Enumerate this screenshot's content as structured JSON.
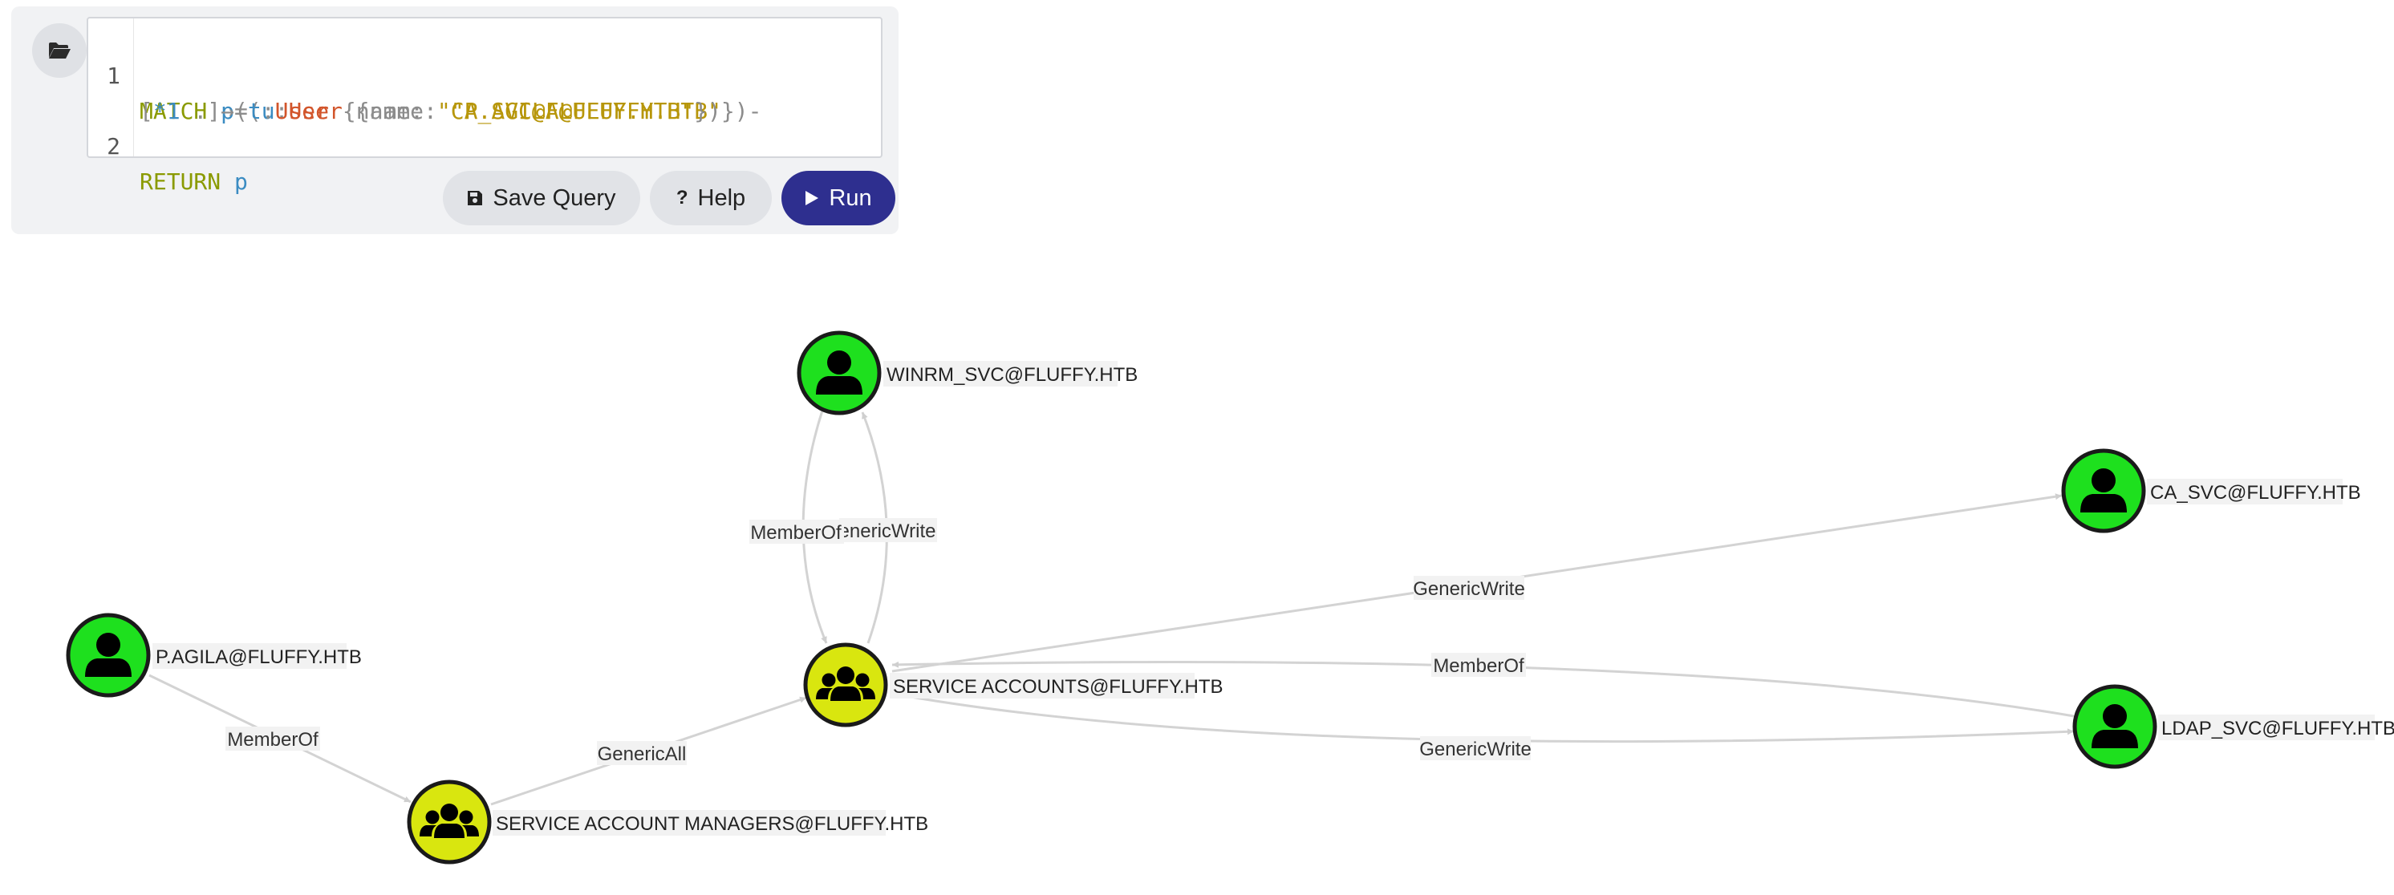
{
  "query": {
    "lines": [
      {
        "number": "1",
        "text": "MATCH p=(u:User {name: \"P.AGILA@FLUFFY.HTB\"})-[*1 .]→(t:User {name: \"CA_SVC@FLUFFY.HTB\"})"
      },
      {
        "number": "2",
        "text": "RETURN p"
      }
    ],
    "tokens": {
      "match": "MATCH",
      "p": "p",
      "eq": "=(",
      "u": "u",
      "colon": ":",
      "user": "User",
      "brace_open": " {",
      "name_key": "name: ",
      "name1": "\"P.AGILA@FLUFFY.HTB\"",
      "close1": "})-",
      "rel_open": "[",
      "rel_star": "*1",
      "rel_dot": " .",
      "rel_close": "]→(",
      "t": "t",
      "name2": "\"CA_SVC@FLUFFY.HTB\"",
      "close2": "})",
      "return": "RETURN",
      "ret_p": "p"
    }
  },
  "buttons": {
    "save_label": "Save Query",
    "help_label": "Help",
    "run_label": "Run",
    "save_icon": "floppy-disk-icon",
    "help_icon": "question-mark-icon",
    "run_icon": "play-icon",
    "open_icon": "folder-open-icon"
  },
  "graph": {
    "nodes": [
      {
        "id": "p_agila",
        "label": "P.AGILA@FLUFFY.HTB",
        "kind": "user"
      },
      {
        "id": "sam",
        "label": "SERVICE ACCOUNT MANAGERS@FLUFFY.HTB",
        "kind": "group"
      },
      {
        "id": "sa",
        "label": "SERVICE ACCOUNTS@FLUFFY.HTB",
        "kind": "group"
      },
      {
        "id": "winrm",
        "label": "WINRM_SVC@FLUFFY.HTB",
        "kind": "user"
      },
      {
        "id": "ca",
        "label": "CA_SVC@FLUFFY.HTB",
        "kind": "user"
      },
      {
        "id": "ldap",
        "label": "LDAP_SVC@FLUFFY.HTB",
        "kind": "user"
      }
    ],
    "edges": [
      {
        "from": "p_agila",
        "to": "sam",
        "label": "MemberOf"
      },
      {
        "from": "sam",
        "to": "sa",
        "label": "GenericAll"
      },
      {
        "from": "winrm",
        "to": "sa",
        "label": "MemberOf"
      },
      {
        "from": "sa",
        "to": "winrm",
        "label": "GenericWrite",
        "displayed": "enericWrite"
      },
      {
        "from": "sa",
        "to": "ca",
        "label": "GenericWrite"
      },
      {
        "from": "ldap",
        "to": "sa",
        "label": "MemberOf"
      },
      {
        "from": "sa",
        "to": "ldap",
        "label": "GenericWrite"
      }
    ],
    "colors": {
      "user_fill": "#1ee01e",
      "group_fill": "#d9e60f",
      "node_stroke": "#1a1a1a",
      "edge": "#d3d3d3",
      "run_button": "#2e2f8f"
    }
  }
}
